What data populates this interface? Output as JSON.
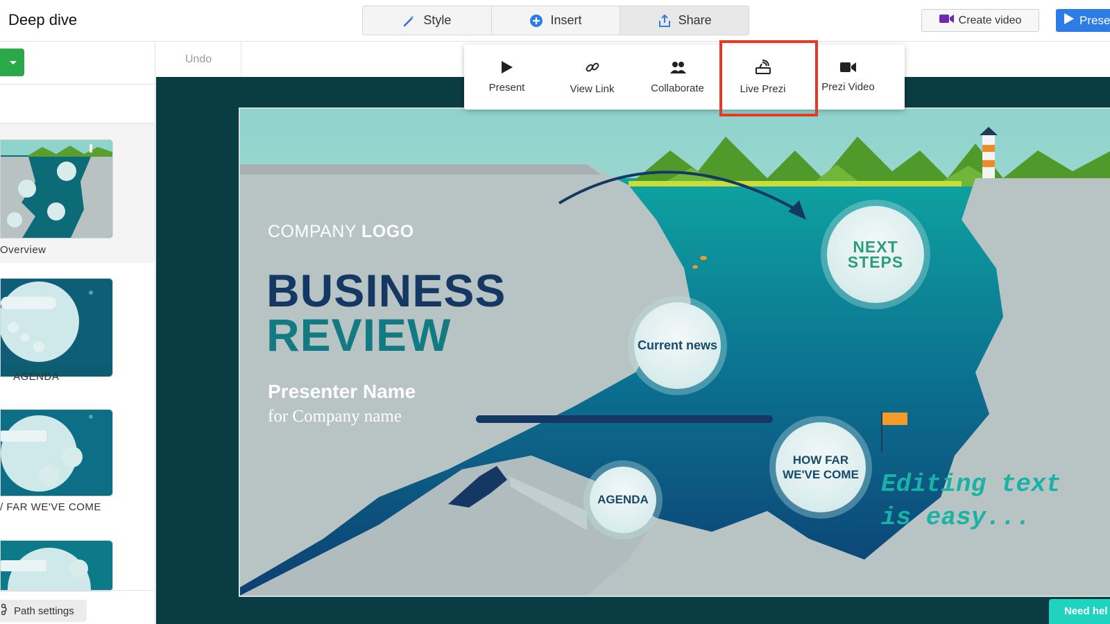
{
  "app": {
    "title": "Deep dive"
  },
  "toolbar": {
    "tabs": [
      {
        "label": "Style",
        "icon": "magic-wand-icon"
      },
      {
        "label": "Insert",
        "icon": "plus-circle-icon"
      },
      {
        "label": "Share",
        "icon": "upload-icon"
      }
    ],
    "create_video_label": "Create video",
    "present_label": "Prese"
  },
  "share_menu": {
    "items": [
      {
        "label": "Present",
        "icon": "play-icon"
      },
      {
        "label": "View Link",
        "icon": "link-icon"
      },
      {
        "label": "Collaborate",
        "icon": "people-icon"
      },
      {
        "label": "Live Prezi",
        "icon": "broadcast-icon",
        "highlighted": true
      },
      {
        "label": "Prezi Video",
        "icon": "video-camera-icon"
      }
    ]
  },
  "undo_label": "Undo",
  "sidebar": {
    "thumbnails": [
      {
        "label": "Overview"
      },
      {
        "label": "AGENDA"
      },
      {
        "label": "/ FAR WE'VE COME"
      },
      {
        "label": ""
      }
    ],
    "path_settings_label": "Path settings"
  },
  "slide": {
    "company_prefix": "COMPANY ",
    "company_logo": "LOGO",
    "title_line1": "BUSINESS",
    "title_line2": "REVIEW",
    "presenter": "Presenter Name",
    "company_name": "for Company name",
    "bubbles": {
      "next_steps": "NEXT\nSTEPS",
      "current_news": "Current news",
      "how_far": "HOW FAR\nWE'VE COME",
      "agenda": "AGENDA"
    },
    "editing_text": "Editing text\nis easy..."
  },
  "help_label": "Need hel",
  "colors": {
    "accent": "#2e7de6",
    "highlight": "#e43a24",
    "add_button": "#2aa84a",
    "help": "#1fd3c0"
  }
}
